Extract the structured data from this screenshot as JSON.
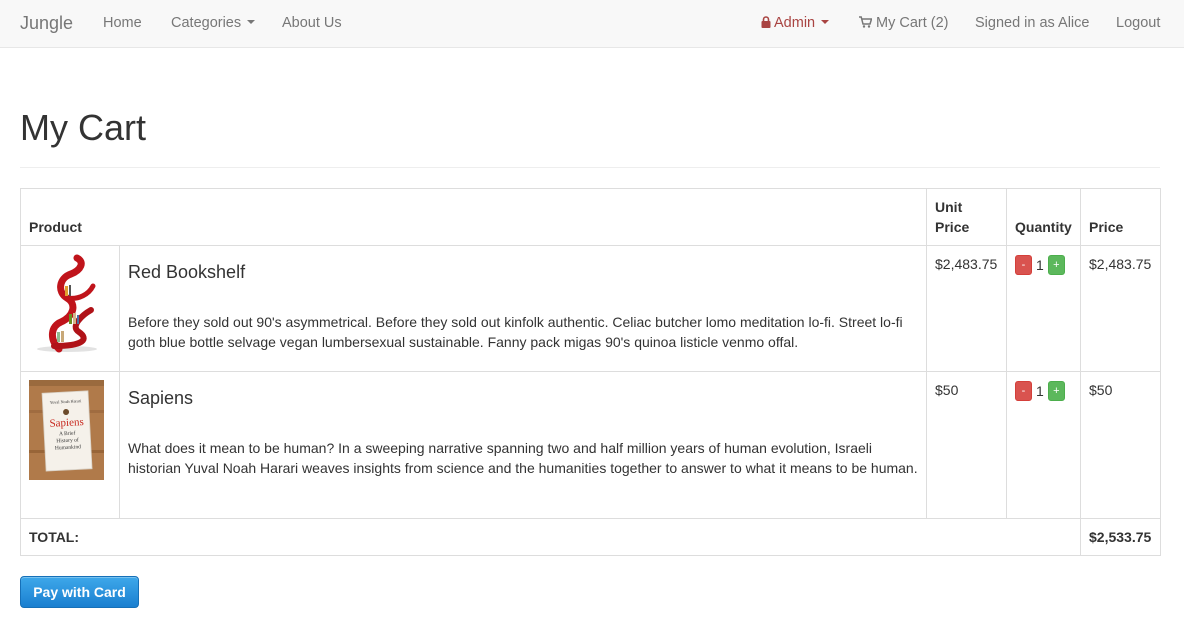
{
  "navbar": {
    "brand": "Jungle",
    "home": "Home",
    "categories": "Categories",
    "about": "About Us",
    "admin": "Admin",
    "cart": "My Cart (2)",
    "signed_in": "Signed in as Alice",
    "logout": "Logout"
  },
  "page": {
    "title": "My Cart"
  },
  "table": {
    "headers": {
      "product": "Product",
      "unit_price_line1": "Unit",
      "unit_price_line2": "Price",
      "quantity": "Quantity",
      "price": "Price"
    },
    "items": [
      {
        "name": "Red Bookshelf",
        "description": "Before they sold out 90's asymmetrical. Before they sold out kinfolk authentic. Celiac butcher lomo meditation lo-fi. Street lo-fi goth blue bottle selvage vegan lumbersexual sustainable. Fanny pack migas 90's quinoa listicle venmo offal.",
        "unit_price": "$2,483.75",
        "quantity": "1",
        "price": "$2,483.75",
        "minus": "-",
        "plus": "+"
      },
      {
        "name": "Sapiens",
        "description": "What does it mean to be human? In a sweeping narrative spanning two and half million years of human evolution, Israeli historian Yuval Noah Harari weaves insights from science and the humanities together to answer to what it means to be human.",
        "unit_price": "$50",
        "quantity": "1",
        "price": "$50",
        "minus": "-",
        "plus": "+",
        "cover": {
          "author": "Yuval Noah Harari",
          "title": "Sapiens",
          "subtitle1": "A Brief",
          "subtitle2": "History of",
          "subtitle3": "Humankind"
        }
      }
    ],
    "total_label": "TOTAL:",
    "total_value": "$2,533.75"
  },
  "actions": {
    "pay_label": "Pay with Card"
  },
  "colors": {
    "admin": "#a94442",
    "minus_button": "#d9534f",
    "plus_button": "#5cb85c",
    "pay_button": "#1a7fd0"
  }
}
